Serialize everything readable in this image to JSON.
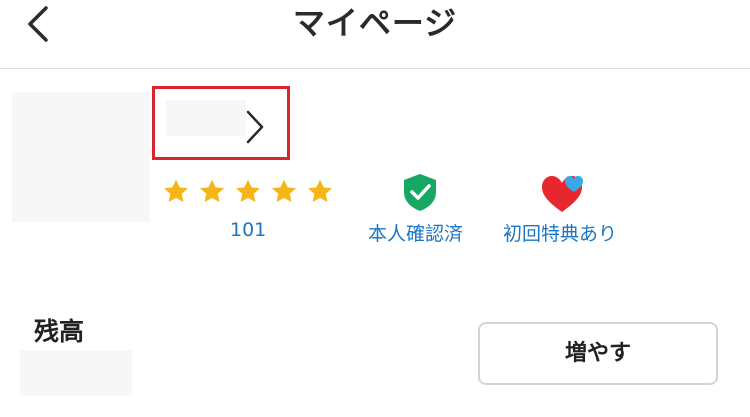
{
  "header": {
    "title": "マイページ",
    "back_icon": "chevron-left-icon"
  },
  "profile": {
    "name_chevron_icon": "chevron-right-icon",
    "highlight_color": "#d9262e",
    "rating": {
      "stars": 5,
      "max_stars": 5,
      "star_color": "#f6b516",
      "count": "101"
    },
    "badges": [
      {
        "icon": "shield-check-icon",
        "label": "本人確認済",
        "color": "#16a862"
      },
      {
        "icon": "hearts-icon",
        "label": "初回特典あり",
        "color": "#e8262e"
      }
    ]
  },
  "balance": {
    "label": "残高",
    "button_label": "増やす"
  },
  "link_color": "#1b76c4"
}
